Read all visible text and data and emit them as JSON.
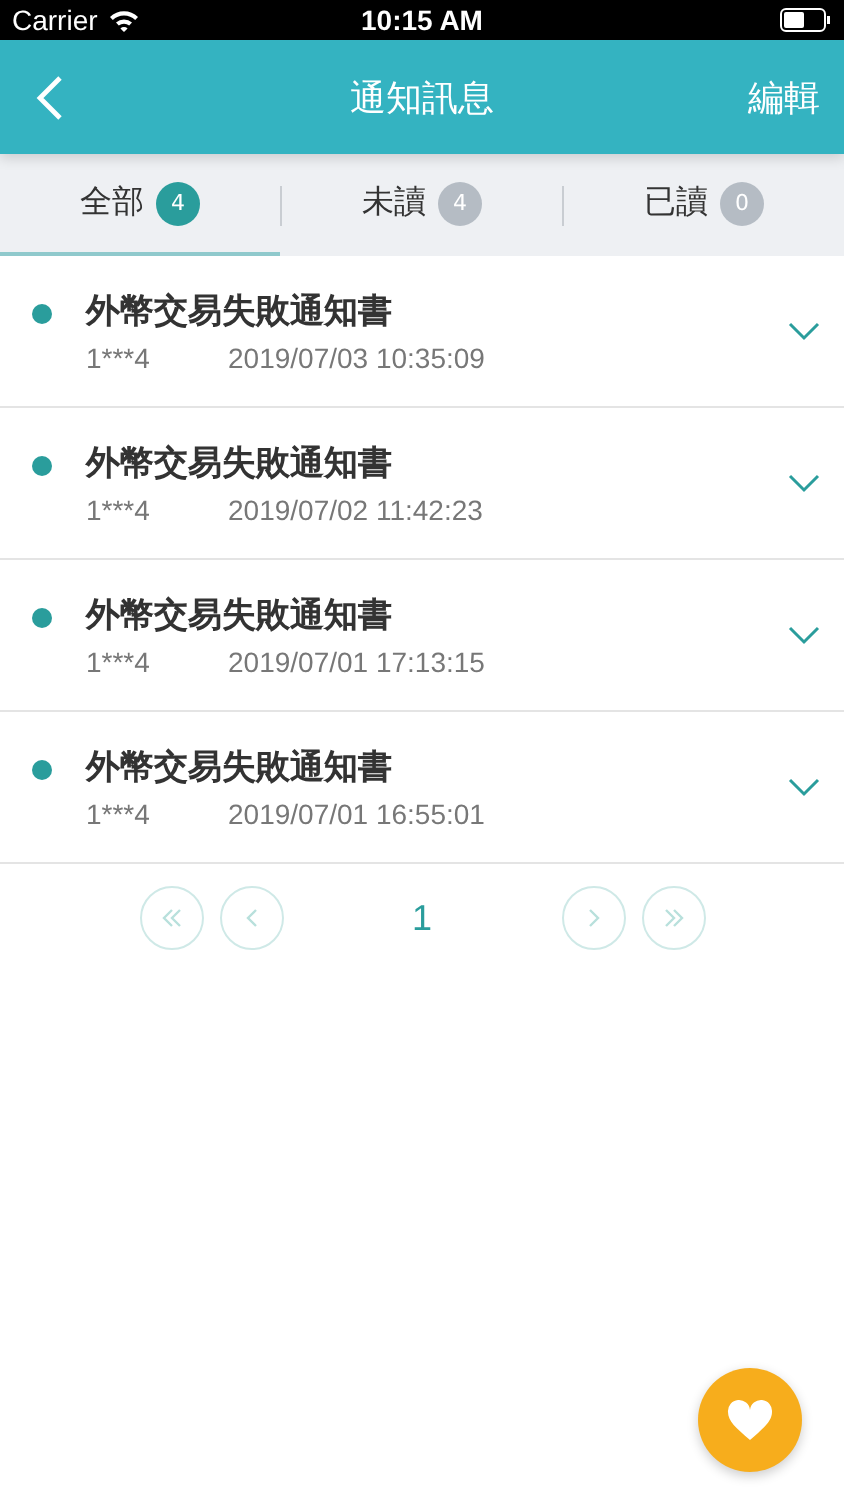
{
  "status_bar": {
    "carrier": "Carrier",
    "time": "10:15 AM"
  },
  "header": {
    "title": "通知訊息",
    "action": "編輯"
  },
  "tabs": [
    {
      "label": "全部",
      "count": "4",
      "selected": true
    },
    {
      "label": "未讀",
      "count": "4",
      "selected": false
    },
    {
      "label": "已讀",
      "count": "0",
      "selected": false
    }
  ],
  "notifications": [
    {
      "title": "外幣交易失敗通知書",
      "account": "1***4",
      "time": "2019/07/03 10:35:09",
      "unread": true
    },
    {
      "title": "外幣交易失敗通知書",
      "account": "1***4",
      "time": "2019/07/02 11:42:23",
      "unread": true
    },
    {
      "title": "外幣交易失敗通知書",
      "account": "1***4",
      "time": "2019/07/01 17:13:15",
      "unread": true
    },
    {
      "title": "外幣交易失敗通知書",
      "account": "1***4",
      "time": "2019/07/01 16:55:01",
      "unread": true
    }
  ],
  "pagination": {
    "page": "1"
  }
}
